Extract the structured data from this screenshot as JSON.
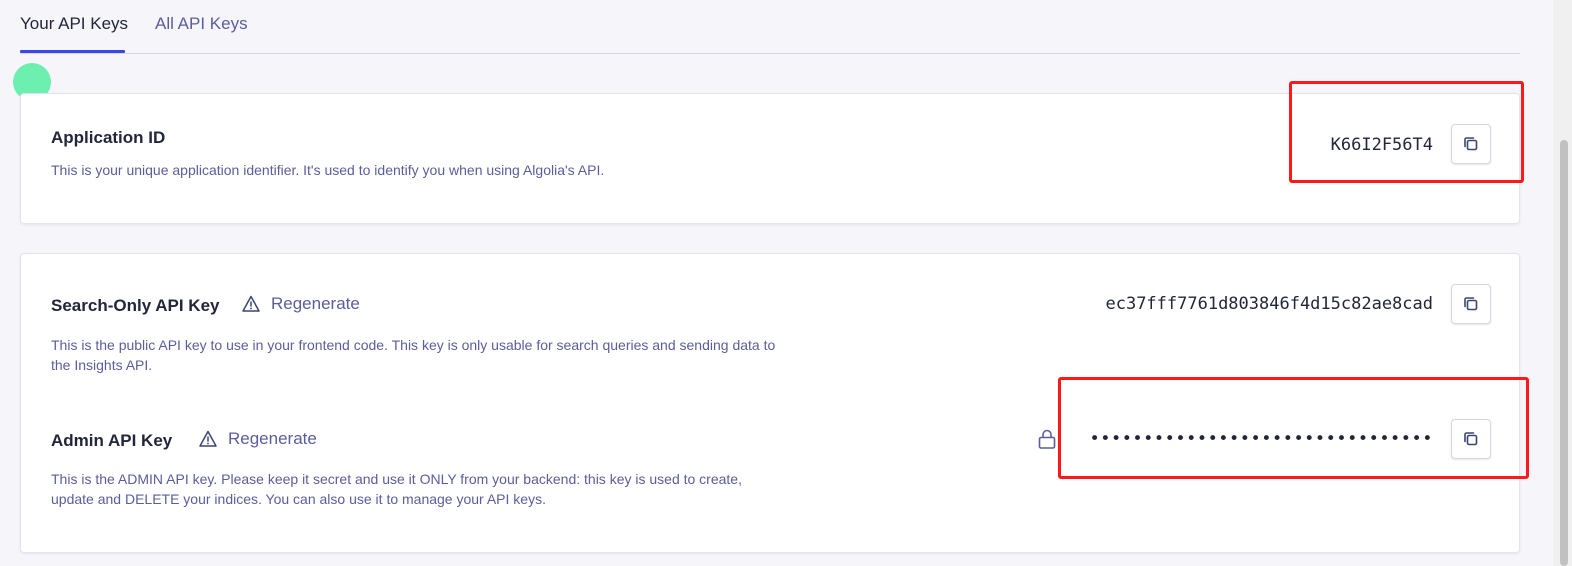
{
  "tabs": [
    {
      "label": "Your API Keys",
      "active": true
    },
    {
      "label": "All API Keys",
      "active": false
    }
  ],
  "application_id": {
    "title": "Application ID",
    "description": "This is your unique application identifier. It's used to identify you when using Algolia's API.",
    "value": "K66I2F56T4",
    "copy_icon": "copy-icon"
  },
  "search_key": {
    "title": "Search-Only API Key",
    "regenerate_label": "Regenerate",
    "warning_icon": "warning-triangle-icon",
    "description": "This is the public API key to use in your frontend code. This key is only usable for search queries and sending data to the Insights API.",
    "value": "ec37fff7761d803846f4d15c82ae8cad",
    "copy_icon": "copy-icon"
  },
  "admin_key": {
    "title": "Admin API Key",
    "regenerate_label": "Regenerate",
    "warning_icon": "warning-triangle-icon",
    "description": "This is the ADMIN API key. Please keep it secret and use it ONLY from your backend: this key is used to create, update and DELETE your indices. You can also use it to manage your API keys.",
    "value": "••••••••••••••••••••••••••••••••",
    "lock_icon": "lock-icon",
    "copy_icon": "copy-icon"
  },
  "colors": {
    "accent": "#3a46e8",
    "text_primary": "#23263b",
    "text_secondary": "#5a5e9a",
    "highlight": "#ff1a1a",
    "cursor_marker": "#5ef0a6"
  }
}
